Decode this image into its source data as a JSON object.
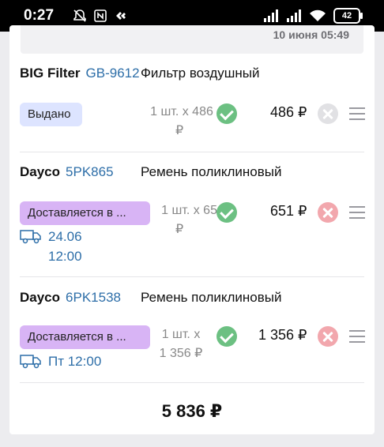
{
  "status_bar": {
    "time": "0:27",
    "battery": "42",
    "icons": [
      "bell-mute-icon",
      "nfc-icon",
      "app-icon",
      "signal-icon",
      "signal-icon",
      "wifi-icon",
      "battery-icon"
    ]
  },
  "top_strip": {
    "date_text": "10 июня 05:49"
  },
  "items": [
    {
      "brand": "BIG Filter",
      "article": "GB-9612",
      "description": "Фильтр воздушный",
      "status": "Выдано",
      "qty_line1": "1 шт. х 486",
      "qty_line2": "₽",
      "price": "486 ₽",
      "removable": false
    },
    {
      "brand": "Dayco",
      "article": "5PK865",
      "description": "Ремень поликлиновый",
      "status": "Доставляется в ...",
      "qty_line1": "1 шт. х 651",
      "qty_line2": "₽",
      "price": "651 ₽",
      "removable": true,
      "delivery_line1": "24.06",
      "delivery_line2": "12:00"
    },
    {
      "brand": "Dayco",
      "article": "6PK1538",
      "description": "Ремень поликлиновый",
      "status": "Доставляется в ...",
      "qty_line1": "1 шт. х",
      "qty_line2": "1 356 ₽",
      "price": "1 356 ₽",
      "removable": true,
      "delivery_line1": "Пт 12:00"
    }
  ],
  "total": "5 836 ₽",
  "colors": {
    "accent_link": "#2d6ea8",
    "status_issued_bg": "#dde4ff",
    "status_delivering_bg": "#d8b4f5",
    "check_green": "#6cc082",
    "remove_red": "#f2a7ad"
  }
}
